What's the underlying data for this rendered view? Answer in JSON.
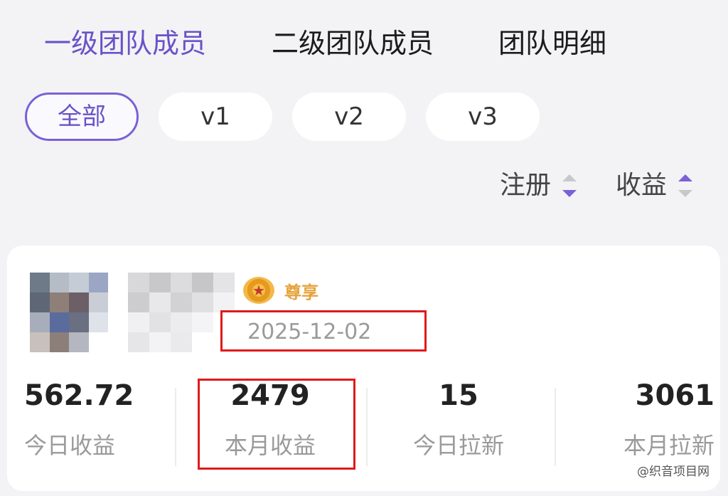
{
  "tabs": [
    {
      "label": "一级团队成员",
      "active": true
    },
    {
      "label": "二级团队成员",
      "active": false
    },
    {
      "label": "团队明细",
      "active": false
    }
  ],
  "filters": [
    {
      "label": "全部",
      "active": true
    },
    {
      "label": "v1",
      "active": false
    },
    {
      "label": "v2",
      "active": false
    },
    {
      "label": "v3",
      "active": false
    }
  ],
  "sort": {
    "register": {
      "label": "注册",
      "direction": "descending"
    },
    "income": {
      "label": "收益",
      "direction": "ascending"
    }
  },
  "member": {
    "vip_badge": "尊享",
    "register_date": "2025-12-02",
    "stats": [
      {
        "value": "562.72",
        "label": "今日收益"
      },
      {
        "value": "2479",
        "label": "本月收益"
      },
      {
        "value": "15",
        "label": "今日拉新"
      },
      {
        "value": "3061",
        "label": "本月拉新"
      }
    ]
  },
  "colors": {
    "accent": "#7b61d6",
    "highlight_box": "#e01a1a"
  },
  "watermark": "@织音项目网"
}
